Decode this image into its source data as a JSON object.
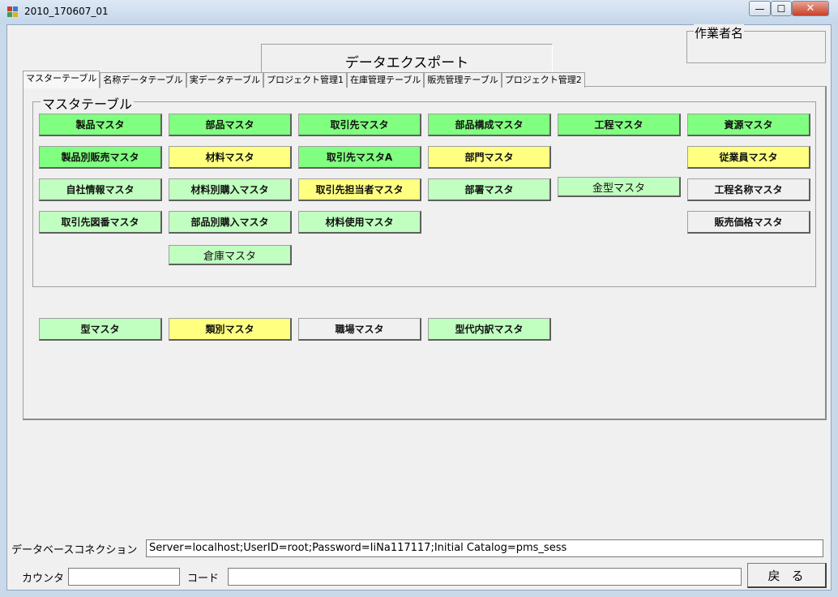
{
  "window": {
    "title": "2010_170607_01",
    "minimize_glyph": "—",
    "maximize_glyph": "☐",
    "close_glyph": "✕"
  },
  "header": {
    "export_title": "データエクスポート",
    "worker_label": "作業者名"
  },
  "tabs": [
    {
      "label": "マスターテーブル",
      "active": true
    },
    {
      "label": "名称データテーブル",
      "active": false
    },
    {
      "label": "実データテーブル",
      "active": false
    },
    {
      "label": "プロジェクト管理1",
      "active": false
    },
    {
      "label": "在庫管理テーブル",
      "active": false
    },
    {
      "label": "販売管理テーブル",
      "active": false
    },
    {
      "label": "プロジェクト管理2",
      "active": false
    }
  ],
  "master_group": {
    "label": "マスタテーブル",
    "buttons": [
      {
        "label": "製品マスタ",
        "color": "#80ff80"
      },
      {
        "label": "部品マスタ",
        "color": "#80ff80"
      },
      {
        "label": "取引先マスタ",
        "color": "#80ff80"
      },
      {
        "label": "部品構成マスタ",
        "color": "#80ff80"
      },
      {
        "label": "工程マスタ",
        "color": "#80ff80"
      },
      {
        "label": "資源マスタ",
        "color": "#80ff80"
      },
      {
        "label": "製品別販売マスタ",
        "color": "#80ff80"
      },
      {
        "label": "材料マスタ",
        "color": "#ffff80"
      },
      {
        "label": "取引先マスタA",
        "color": "#80ff80"
      },
      {
        "label": "部門マスタ",
        "color": "#ffff80"
      },
      {
        "label": "従業員マスタ",
        "color": "#ffff80"
      },
      {
        "label": "自社情報マスタ",
        "color": "#c0ffc0"
      },
      {
        "label": "材料別購入マスタ",
        "color": "#c0ffc0"
      },
      {
        "label": "取引先担当者マスタ",
        "color": "#ffff80"
      },
      {
        "label": "部署マスタ",
        "color": "#c0ffc0"
      },
      {
        "label": "金型マスタ",
        "color": "#c0ffc0"
      },
      {
        "label": "工程名称マスタ",
        "color": "#f0f0f0"
      },
      {
        "label": "取引先図番マスタ",
        "color": "#c0ffc0"
      },
      {
        "label": "部品別購入マスタ",
        "color": "#c0ffc0"
      },
      {
        "label": "材料使用マスタ",
        "color": "#c0ffc0"
      },
      {
        "label": "販売価格マスタ",
        "color": "#f0f0f0"
      },
      {
        "label": "倉庫マスタ",
        "color": "#c0ffc0"
      }
    ]
  },
  "extra_buttons": [
    {
      "label": "型マスタ",
      "color": "#c0ffc0"
    },
    {
      "label": "類別マスタ",
      "color": "#ffff80"
    },
    {
      "label": "職場マスタ",
      "color": "#f0f0f0"
    },
    {
      "label": "型代内訳マスタ",
      "color": "#c0ffc0"
    }
  ],
  "footer": {
    "db_connection_label": "データベースコネクション",
    "db_connection_value": "Server=localhost;UserID=root;Password=IiNa117117;Initial Catalog=pms_sess",
    "counter_label": "カウンタ",
    "counter_value": "",
    "code_label": "コード",
    "code_value": "",
    "back_label": "戻る"
  }
}
